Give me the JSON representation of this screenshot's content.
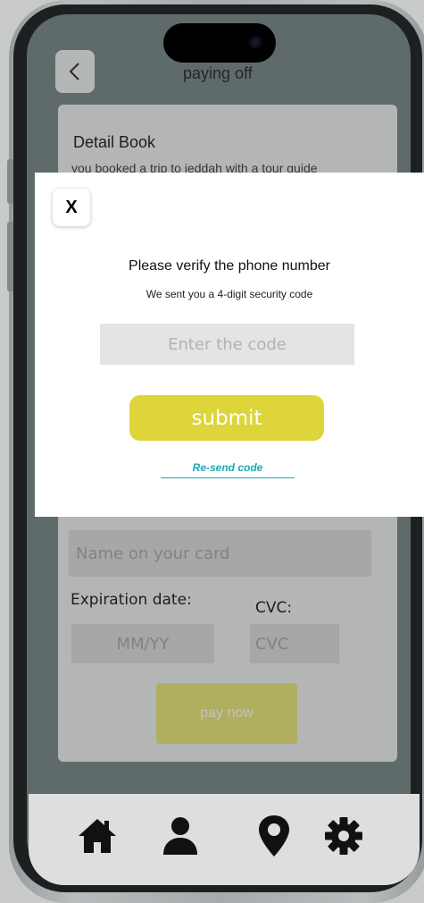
{
  "header": {
    "title": "paying off"
  },
  "card": {
    "title": "Detail Book",
    "description": "you booked a trip to jeddah with a tour guide"
  },
  "payment_form": {
    "name_placeholder": "Name on your card",
    "expiration_label": "Expiration date:",
    "cvc_label": "CVC:",
    "expiry_placeholder": "MM/YY",
    "cvc_placeholder": "CVC",
    "pay_button": "pay now"
  },
  "modal": {
    "close_label": "X",
    "title": "Please verify the phone number",
    "subtitle": "We sent you a 4-digit security code",
    "code_placeholder": "Enter the code",
    "submit_label": "submit",
    "resend_label": "Re-send code"
  },
  "bottom_nav": {
    "items": [
      "home-icon",
      "profile-icon",
      "location-pin-icon",
      "settings-gear-icon"
    ]
  },
  "colors": {
    "accent_yellow": "#ddd53a",
    "link_teal": "#18a9b8",
    "screen_bg": "#6d7b7b"
  }
}
